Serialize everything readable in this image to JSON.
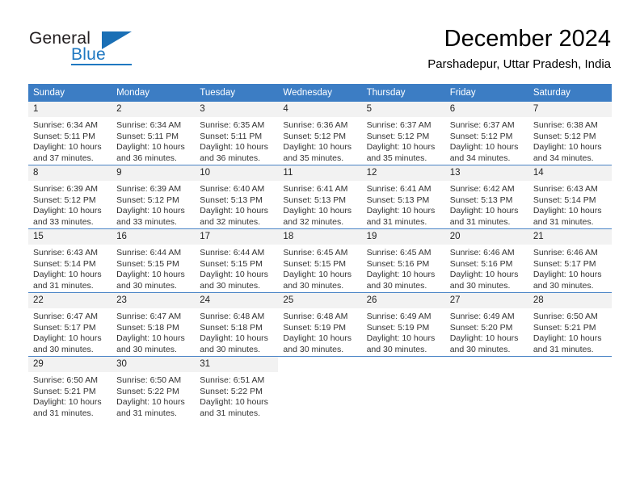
{
  "brand": {
    "name_top": "General",
    "name_bottom": "Blue",
    "triangle_icon": "triangle-icon",
    "color_dark": "#231f20",
    "color_blue": "#1f78c1"
  },
  "header": {
    "title": "December 2024",
    "subtitle": "Parshadepur, Uttar Pradesh, India"
  },
  "theme": {
    "header_band": "#3c7dc4",
    "daynum_band": "#f2f2f2",
    "row_divider": "#4a84c6",
    "text": "#333333"
  },
  "weekday_headers": [
    "Sunday",
    "Monday",
    "Tuesday",
    "Wednesday",
    "Thursday",
    "Friday",
    "Saturday"
  ],
  "weeks": [
    [
      {
        "day": "1",
        "sunrise": "Sunrise: 6:34 AM",
        "sunset": "Sunset: 5:11 PM",
        "daylight1": "Daylight: 10 hours",
        "daylight2": "and 37 minutes."
      },
      {
        "day": "2",
        "sunrise": "Sunrise: 6:34 AM",
        "sunset": "Sunset: 5:11 PM",
        "daylight1": "Daylight: 10 hours",
        "daylight2": "and 36 minutes."
      },
      {
        "day": "3",
        "sunrise": "Sunrise: 6:35 AM",
        "sunset": "Sunset: 5:11 PM",
        "daylight1": "Daylight: 10 hours",
        "daylight2": "and 36 minutes."
      },
      {
        "day": "4",
        "sunrise": "Sunrise: 6:36 AM",
        "sunset": "Sunset: 5:12 PM",
        "daylight1": "Daylight: 10 hours",
        "daylight2": "and 35 minutes."
      },
      {
        "day": "5",
        "sunrise": "Sunrise: 6:37 AM",
        "sunset": "Sunset: 5:12 PM",
        "daylight1": "Daylight: 10 hours",
        "daylight2": "and 35 minutes."
      },
      {
        "day": "6",
        "sunrise": "Sunrise: 6:37 AM",
        "sunset": "Sunset: 5:12 PM",
        "daylight1": "Daylight: 10 hours",
        "daylight2": "and 34 minutes."
      },
      {
        "day": "7",
        "sunrise": "Sunrise: 6:38 AM",
        "sunset": "Sunset: 5:12 PM",
        "daylight1": "Daylight: 10 hours",
        "daylight2": "and 34 minutes."
      }
    ],
    [
      {
        "day": "8",
        "sunrise": "Sunrise: 6:39 AM",
        "sunset": "Sunset: 5:12 PM",
        "daylight1": "Daylight: 10 hours",
        "daylight2": "and 33 minutes."
      },
      {
        "day": "9",
        "sunrise": "Sunrise: 6:39 AM",
        "sunset": "Sunset: 5:12 PM",
        "daylight1": "Daylight: 10 hours",
        "daylight2": "and 33 minutes."
      },
      {
        "day": "10",
        "sunrise": "Sunrise: 6:40 AM",
        "sunset": "Sunset: 5:13 PM",
        "daylight1": "Daylight: 10 hours",
        "daylight2": "and 32 minutes."
      },
      {
        "day": "11",
        "sunrise": "Sunrise: 6:41 AM",
        "sunset": "Sunset: 5:13 PM",
        "daylight1": "Daylight: 10 hours",
        "daylight2": "and 32 minutes."
      },
      {
        "day": "12",
        "sunrise": "Sunrise: 6:41 AM",
        "sunset": "Sunset: 5:13 PM",
        "daylight1": "Daylight: 10 hours",
        "daylight2": "and 31 minutes."
      },
      {
        "day": "13",
        "sunrise": "Sunrise: 6:42 AM",
        "sunset": "Sunset: 5:13 PM",
        "daylight1": "Daylight: 10 hours",
        "daylight2": "and 31 minutes."
      },
      {
        "day": "14",
        "sunrise": "Sunrise: 6:43 AM",
        "sunset": "Sunset: 5:14 PM",
        "daylight1": "Daylight: 10 hours",
        "daylight2": "and 31 minutes."
      }
    ],
    [
      {
        "day": "15",
        "sunrise": "Sunrise: 6:43 AM",
        "sunset": "Sunset: 5:14 PM",
        "daylight1": "Daylight: 10 hours",
        "daylight2": "and 31 minutes."
      },
      {
        "day": "16",
        "sunrise": "Sunrise: 6:44 AM",
        "sunset": "Sunset: 5:15 PM",
        "daylight1": "Daylight: 10 hours",
        "daylight2": "and 30 minutes."
      },
      {
        "day": "17",
        "sunrise": "Sunrise: 6:44 AM",
        "sunset": "Sunset: 5:15 PM",
        "daylight1": "Daylight: 10 hours",
        "daylight2": "and 30 minutes."
      },
      {
        "day": "18",
        "sunrise": "Sunrise: 6:45 AM",
        "sunset": "Sunset: 5:15 PM",
        "daylight1": "Daylight: 10 hours",
        "daylight2": "and 30 minutes."
      },
      {
        "day": "19",
        "sunrise": "Sunrise: 6:45 AM",
        "sunset": "Sunset: 5:16 PM",
        "daylight1": "Daylight: 10 hours",
        "daylight2": "and 30 minutes."
      },
      {
        "day": "20",
        "sunrise": "Sunrise: 6:46 AM",
        "sunset": "Sunset: 5:16 PM",
        "daylight1": "Daylight: 10 hours",
        "daylight2": "and 30 minutes."
      },
      {
        "day": "21",
        "sunrise": "Sunrise: 6:46 AM",
        "sunset": "Sunset: 5:17 PM",
        "daylight1": "Daylight: 10 hours",
        "daylight2": "and 30 minutes."
      }
    ],
    [
      {
        "day": "22",
        "sunrise": "Sunrise: 6:47 AM",
        "sunset": "Sunset: 5:17 PM",
        "daylight1": "Daylight: 10 hours",
        "daylight2": "and 30 minutes."
      },
      {
        "day": "23",
        "sunrise": "Sunrise: 6:47 AM",
        "sunset": "Sunset: 5:18 PM",
        "daylight1": "Daylight: 10 hours",
        "daylight2": "and 30 minutes."
      },
      {
        "day": "24",
        "sunrise": "Sunrise: 6:48 AM",
        "sunset": "Sunset: 5:18 PM",
        "daylight1": "Daylight: 10 hours",
        "daylight2": "and 30 minutes."
      },
      {
        "day": "25",
        "sunrise": "Sunrise: 6:48 AM",
        "sunset": "Sunset: 5:19 PM",
        "daylight1": "Daylight: 10 hours",
        "daylight2": "and 30 minutes."
      },
      {
        "day": "26",
        "sunrise": "Sunrise: 6:49 AM",
        "sunset": "Sunset: 5:19 PM",
        "daylight1": "Daylight: 10 hours",
        "daylight2": "and 30 minutes."
      },
      {
        "day": "27",
        "sunrise": "Sunrise: 6:49 AM",
        "sunset": "Sunset: 5:20 PM",
        "daylight1": "Daylight: 10 hours",
        "daylight2": "and 30 minutes."
      },
      {
        "day": "28",
        "sunrise": "Sunrise: 6:50 AM",
        "sunset": "Sunset: 5:21 PM",
        "daylight1": "Daylight: 10 hours",
        "daylight2": "and 31 minutes."
      }
    ],
    [
      {
        "day": "29",
        "sunrise": "Sunrise: 6:50 AM",
        "sunset": "Sunset: 5:21 PM",
        "daylight1": "Daylight: 10 hours",
        "daylight2": "and 31 minutes."
      },
      {
        "day": "30",
        "sunrise": "Sunrise: 6:50 AM",
        "sunset": "Sunset: 5:22 PM",
        "daylight1": "Daylight: 10 hours",
        "daylight2": "and 31 minutes."
      },
      {
        "day": "31",
        "sunrise": "Sunrise: 6:51 AM",
        "sunset": "Sunset: 5:22 PM",
        "daylight1": "Daylight: 10 hours",
        "daylight2": "and 31 minutes."
      },
      {
        "day": "",
        "sunrise": "",
        "sunset": "",
        "daylight1": "",
        "daylight2": ""
      },
      {
        "day": "",
        "sunrise": "",
        "sunset": "",
        "daylight1": "",
        "daylight2": ""
      },
      {
        "day": "",
        "sunrise": "",
        "sunset": "",
        "daylight1": "",
        "daylight2": ""
      },
      {
        "day": "",
        "sunrise": "",
        "sunset": "",
        "daylight1": "",
        "daylight2": ""
      }
    ]
  ]
}
